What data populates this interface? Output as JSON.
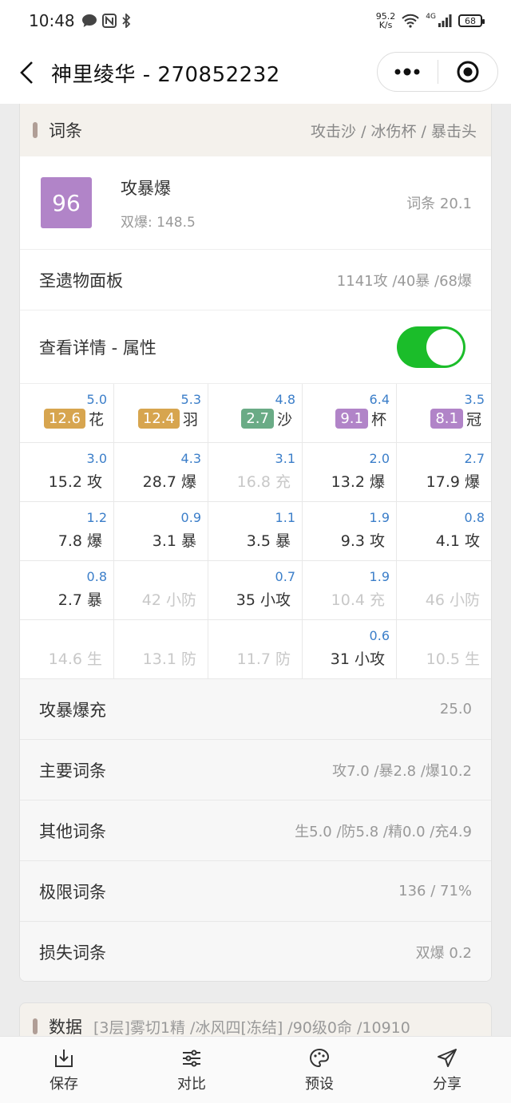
{
  "status": {
    "time": "10:48",
    "net_speed": "95.2",
    "net_unit": "K/s",
    "signal": "4G",
    "battery": "68"
  },
  "titlebar": {
    "title": "神里绫华 - 270852232"
  },
  "section": {
    "title": "词条",
    "subtitle": "攻击沙 / 冰伤杯 / 暴击头"
  },
  "score": {
    "value": "96",
    "name": "攻暴爆",
    "sub": "双爆: 148.5",
    "right": "词条 20.1"
  },
  "panel": {
    "label": "圣遗物面板",
    "value": "1141攻 /40暴 /68爆"
  },
  "detail": {
    "label": "查看详情 - 属性",
    "toggle_on": true
  },
  "grid": [
    [
      {
        "score": "5.0",
        "chip": "12.6",
        "chip_color": "#d7a54f",
        "label": "花"
      },
      {
        "score": "5.3",
        "chip": "12.4",
        "chip_color": "#d7a54f",
        "label": "羽"
      },
      {
        "score": "4.8",
        "chip": "2.7",
        "chip_color": "#6aab86",
        "label": "沙"
      },
      {
        "score": "6.4",
        "chip": "9.1",
        "chip_color": "#b184c8",
        "label": "杯"
      },
      {
        "score": "3.5",
        "chip": "8.1",
        "chip_color": "#b184c8",
        "label": "冠"
      }
    ],
    [
      {
        "score": "3.0",
        "text": "15.2 攻",
        "dim": false
      },
      {
        "score": "4.3",
        "text": "28.7 爆",
        "dim": false
      },
      {
        "score": "3.1",
        "text": "16.8 充",
        "dim": true
      },
      {
        "score": "2.0",
        "text": "13.2 爆",
        "dim": false
      },
      {
        "score": "2.7",
        "text": "17.9 爆",
        "dim": false
      }
    ],
    [
      {
        "score": "1.2",
        "text": "7.8 爆",
        "dim": false
      },
      {
        "score": "0.9",
        "text": "3.1 暴",
        "dim": false
      },
      {
        "score": "1.1",
        "text": "3.5 暴",
        "dim": false
      },
      {
        "score": "1.9",
        "text": "9.3 攻",
        "dim": false
      },
      {
        "score": "0.8",
        "text": "4.1 攻",
        "dim": false
      }
    ],
    [
      {
        "score": "0.8",
        "text": "2.7 暴",
        "dim": false
      },
      {
        "score": "",
        "text": "42 小防",
        "dim": true
      },
      {
        "score": "0.7",
        "text": "35 小攻",
        "dim": false
      },
      {
        "score": "1.9",
        "text": "10.4 充",
        "dim": true
      },
      {
        "score": "",
        "text": "46 小防",
        "dim": true
      }
    ],
    [
      {
        "score": "",
        "text": "14.6 生",
        "dim": true
      },
      {
        "score": "",
        "text": "13.1 防",
        "dim": true
      },
      {
        "score": "",
        "text": "11.7 防",
        "dim": true
      },
      {
        "score": "0.6",
        "text": "31 小攻",
        "dim": false
      },
      {
        "score": "",
        "text": "10.5 生",
        "dim": true
      }
    ]
  ],
  "stats": [
    {
      "label": "攻暴爆充",
      "value": "25.0"
    },
    {
      "label": "主要词条",
      "value": "攻7.0 /暴2.8 /爆10.2"
    },
    {
      "label": "其他词条",
      "value": "生5.0 /防5.8 /精0.0 /充4.9"
    },
    {
      "label": "极限词条",
      "value": "136 / 71%"
    },
    {
      "label": "损失词条",
      "value": "双爆 0.2"
    }
  ],
  "data_section": {
    "title": "数据",
    "desc": "[3层]雾切1精 /冰风四[冻结] /90级0命 /10910"
  },
  "tabs": [
    {
      "label": "保存",
      "icon": "download-icon"
    },
    {
      "label": "对比",
      "icon": "sliders-icon"
    },
    {
      "label": "预设",
      "icon": "palette-icon"
    },
    {
      "label": "分享",
      "icon": "send-icon"
    }
  ]
}
